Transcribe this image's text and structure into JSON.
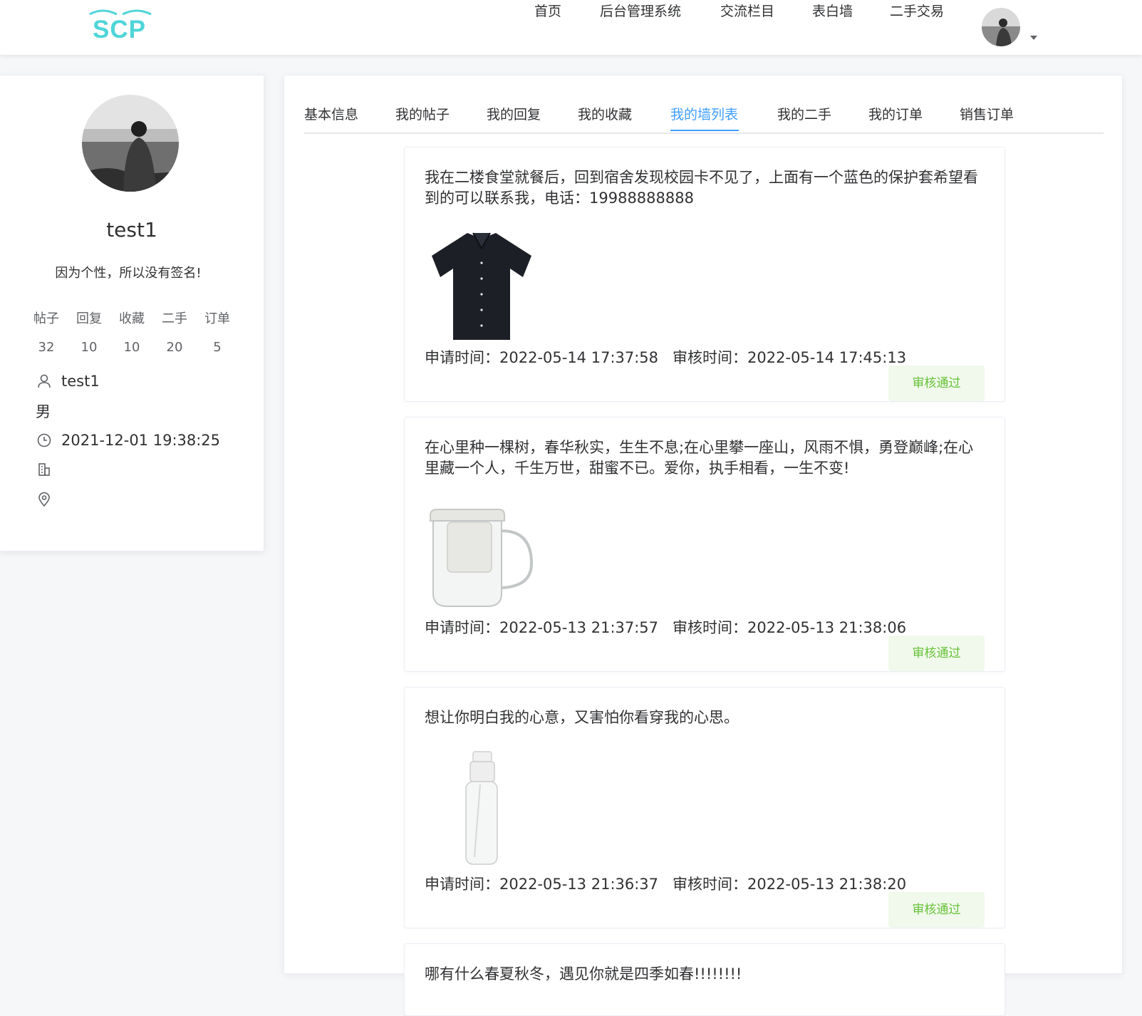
{
  "header": {
    "logo_text": "SCP",
    "nav": [
      "首页",
      "后台管理系统",
      "交流栏目",
      "表白墙",
      "二手交易"
    ]
  },
  "profile": {
    "name": "test1",
    "signature": "因为个性，所以没有签名!",
    "stats": [
      {
        "label": "帖子",
        "value": "32"
      },
      {
        "label": "回复",
        "value": "10"
      },
      {
        "label": "收藏",
        "value": "10"
      },
      {
        "label": "二手",
        "value": "20"
      },
      {
        "label": "订单",
        "value": "5"
      }
    ],
    "username": "test1",
    "gender": "男",
    "created_at": "2021-12-01 19:38:25",
    "company": "",
    "location": ""
  },
  "tabs": [
    "基本信息",
    "我的帖子",
    "我的回复",
    "我的收藏",
    "我的墙列表",
    "我的二手",
    "我的订单",
    "销售订单"
  ],
  "active_tab": "我的墙列表",
  "labels": {
    "apply_time": "申请时间：",
    "review_time": "审核时间："
  },
  "posts": [
    {
      "text": "我在二楼食堂就餐后，回到宿舍发现校园卡不见了，上面有一个蓝色的保护套希望看到的可以联系我，电话：19988888888",
      "image_icon": "black-shirt-icon",
      "apply_time": "2022-05-14 17:37:58",
      "review_time": "2022-05-14 17:45:13",
      "status": "审核通过"
    },
    {
      "text": "在心里种一棵树，春华秋实，生生不息;在心里攀一座山，风雨不惧，勇登巅峰;在心里藏一个人，千生万世，甜蜜不已。爱你，执手相看，一生不变!",
      "image_icon": "glass-teapot-icon",
      "apply_time": "2022-05-13 21:37:57",
      "review_time": "2022-05-13 21:38:06",
      "status": "审核通过"
    },
    {
      "text": "想让你明白我的心意，又害怕你看穿我的心思。",
      "image_icon": "spray-bottle-icon",
      "apply_time": "2022-05-13 21:36:37",
      "review_time": "2022-05-13 21:38:20",
      "status": "审核通过"
    },
    {
      "text": "哪有什么春夏秋冬，遇见你就是四季如春!!!!!!!!"
    }
  ],
  "colors": {
    "accent": "#409eff",
    "success": "#67c23a",
    "success_bg": "#f0f9eb",
    "logo": "#4fd5d9"
  }
}
